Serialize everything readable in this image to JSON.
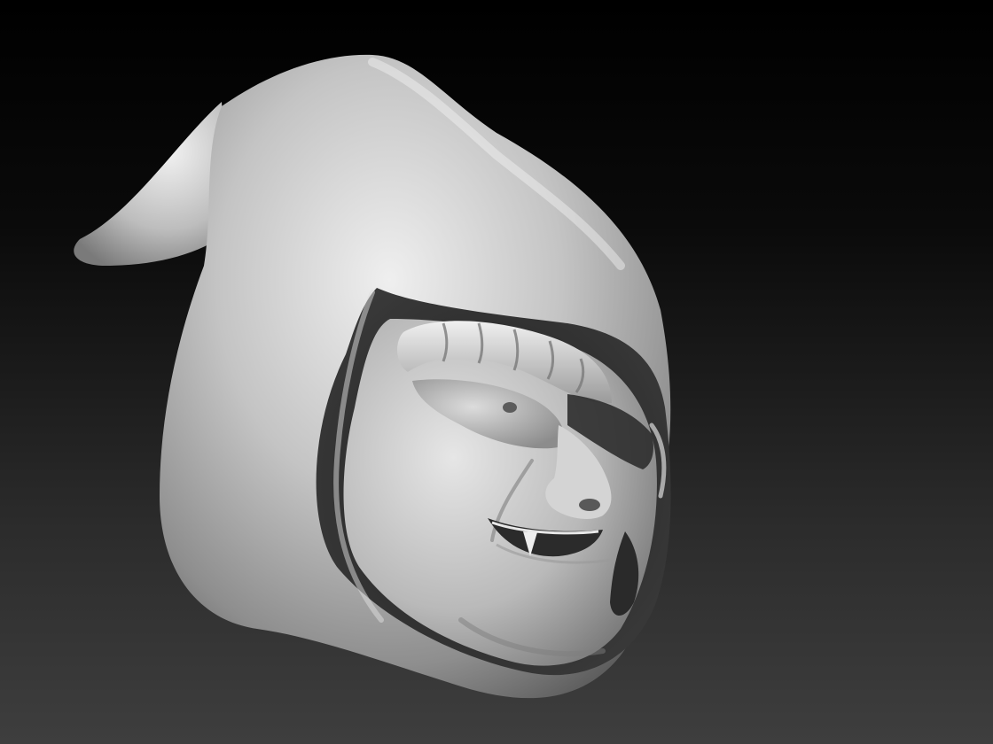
{
  "viewport": {
    "background_top": "#000000",
    "background_bottom": "#3e3e3e"
  },
  "model": {
    "material_color": "#c9c9c9",
    "highlight_color": "#f0f0f0",
    "shadow_color": "#2a2a2a"
  }
}
